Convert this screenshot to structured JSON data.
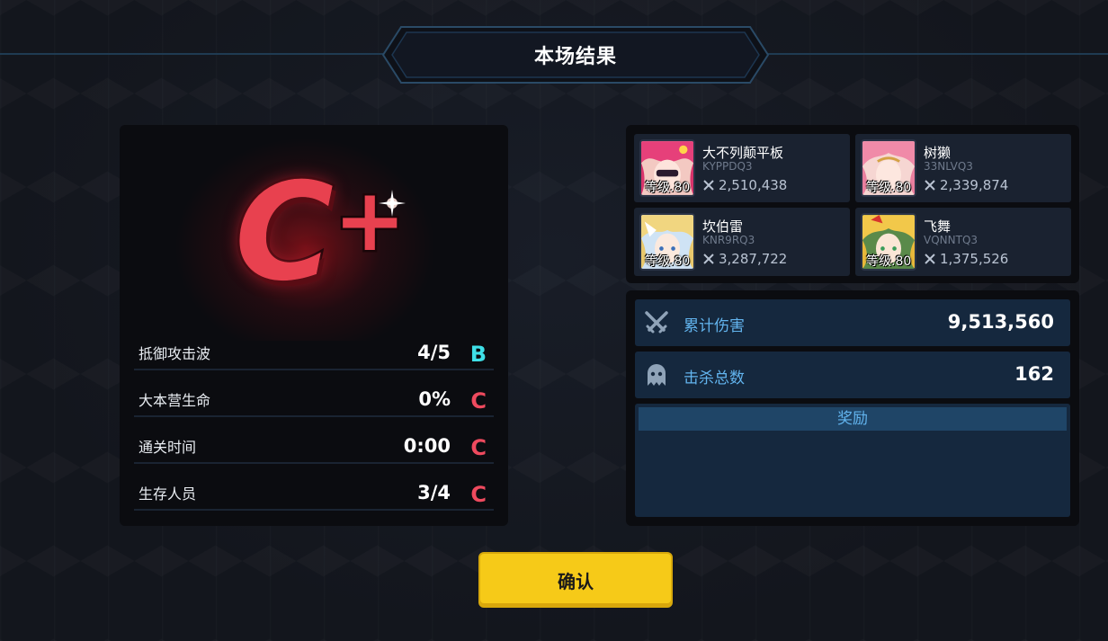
{
  "header": {
    "title": "本场结果"
  },
  "grade": {
    "letter": "C",
    "modifier": "+",
    "color": "#e8414f"
  },
  "stats": [
    {
      "label": "抵御攻击波",
      "value": "4/5",
      "grade": "B",
      "grade_color": "#3fe0e8"
    },
    {
      "label": "大本营生命",
      "value": "0%",
      "grade": "C",
      "grade_color": "#ee4a5e"
    },
    {
      "label": "通关时间",
      "value": "0:00",
      "grade": "C",
      "grade_color": "#ee4a5e"
    },
    {
      "label": "生存人员",
      "value": "3/4",
      "grade": "C",
      "grade_color": "#ee4a5e"
    }
  ],
  "players": [
    {
      "name": "大不列颠平板",
      "id": "KYPPDQ3",
      "power": "2,510,438",
      "level": "等级.80",
      "avatar_icon": "character-portrait-pink-hair"
    },
    {
      "name": "树獭",
      "id": "33NLVQ3",
      "power": "2,339,874",
      "level": "等级.80",
      "avatar_icon": "character-portrait-rose-hair"
    },
    {
      "name": "坎伯雷",
      "id": "KNR9RQ3",
      "power": "3,287,722",
      "level": "等级.80",
      "avatar_icon": "character-portrait-blonde-hair"
    },
    {
      "name": "飞舞",
      "id": "VQNNTQ3",
      "power": "1,375,526",
      "level": "等级.80",
      "avatar_icon": "character-portrait-gold-hair"
    }
  ],
  "summary": {
    "damage": {
      "label": "累计伤害",
      "value": "9,513,560",
      "icon": "crossed-swords-icon"
    },
    "kills": {
      "label": "击杀总数",
      "value": "162",
      "icon": "ghost-icon"
    }
  },
  "rewards": {
    "title": "奖励"
  },
  "confirm": {
    "label": "确认",
    "color": "#f6ca18"
  }
}
